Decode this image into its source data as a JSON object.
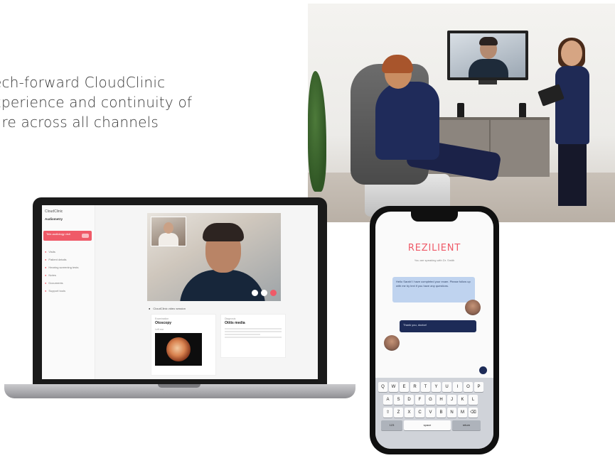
{
  "headline": {
    "line1": "ech-forward CloudClinic",
    "line2": "xperience and continuity of",
    "line3": "are across all channels"
  },
  "laptop_app": {
    "app_name": "CloudClinic",
    "subheader": "Audiometry",
    "active_item": "Tele-audiology visit",
    "nav_items": [
      "Visits",
      "Patient details",
      "Hearing screening tests",
      "Notes",
      "Documents",
      "Support tools"
    ],
    "session_label": "CloudClinic video session",
    "card1": {
      "label": "Examination",
      "value": "Otoscopy",
      "image_label": "Left ear"
    },
    "card2": {
      "label": "Diagnosis",
      "value": "Otitis media"
    }
  },
  "phone": {
    "brand": "REZILIENT",
    "subtitle": "You are speaking with Dr. Smith",
    "message_in": "Hello Sarah! I have completed your exam. Please follow up with me by text if you have any questions.",
    "message_out": "Thank you, doctor!",
    "keyboard_rows": [
      [
        "Q",
        "W",
        "E",
        "R",
        "T",
        "Y",
        "U",
        "I",
        "O",
        "P"
      ],
      [
        "A",
        "S",
        "D",
        "F",
        "G",
        "H",
        "J",
        "K",
        "L"
      ],
      [
        "⇧",
        "Z",
        "X",
        "C",
        "V",
        "B",
        "N",
        "M",
        "⌫"
      ]
    ],
    "keyboard_bottom": [
      "123",
      "space",
      "return"
    ]
  }
}
